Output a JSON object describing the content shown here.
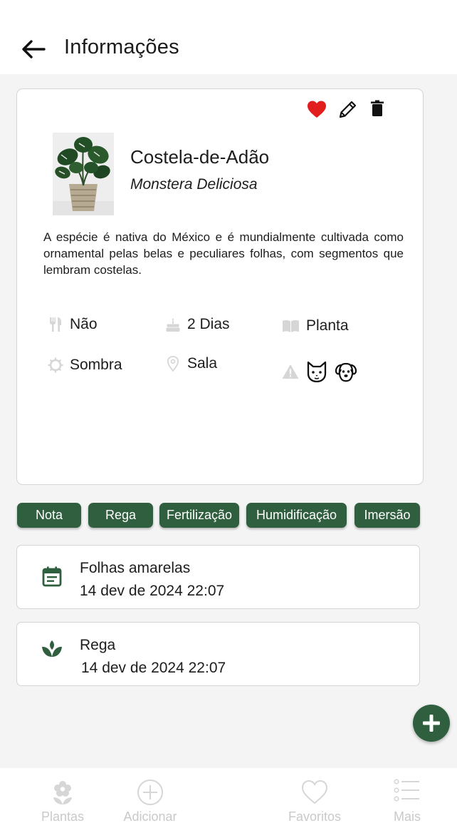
{
  "header": {
    "title": "Informações"
  },
  "plant": {
    "common_name": "Costela-de-Adão",
    "scientific_name": "Monstera Deliciosa",
    "description": "A espécie é nativa do México e é mundialmente cultivada como ornamental pelas belas e peculiares folhas, com segmentos que lembram costelas.",
    "favorite": true,
    "attributes": {
      "edible": "Não",
      "watering_interval": "2 Dias",
      "category": "Planta",
      "light": "Sombra",
      "location": "Sala"
    },
    "toxic_to": [
      "cat-icon",
      "dog-icon"
    ]
  },
  "filters": [
    "Nota",
    "Rega",
    "Fertilização",
    "Humidificação",
    "Imersão"
  ],
  "logs": [
    {
      "title": "Folhas amarelas",
      "date": "14 dev de 2024 22:07",
      "icon": "calendar-note-icon"
    },
    {
      "title": "Rega",
      "date": "14 dev de 2024 22:07",
      "icon": "sprout-icon"
    }
  ],
  "nav": [
    "Plantas",
    "Adicionar",
    "Favoritos",
    "Mais"
  ],
  "colors": {
    "primary": "#2f5f3f",
    "favorite": "#e11d1d",
    "muted_icon": "#d6d6d6",
    "nav_text": "#c9c9c9"
  }
}
